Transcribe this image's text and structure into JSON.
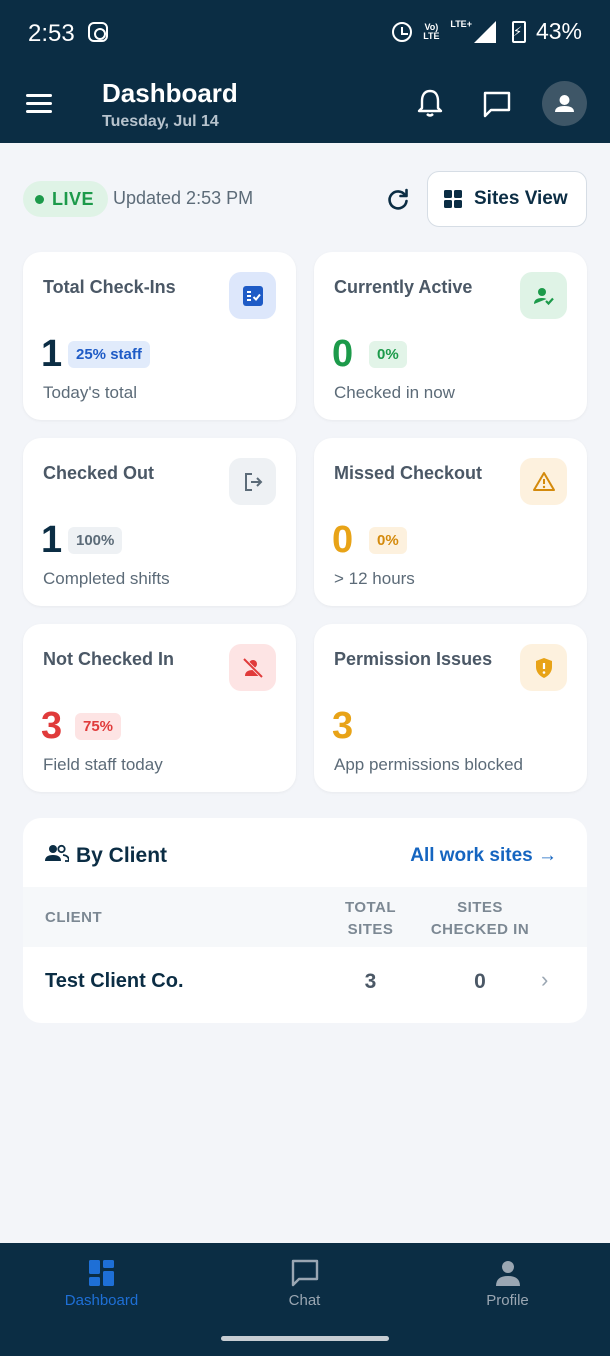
{
  "status_bar": {
    "time": "2:53",
    "volte": "Vo) LTE",
    "network": "LTE+",
    "battery": "43%"
  },
  "header": {
    "title": "Dashboard",
    "date": "Tuesday, Jul 14"
  },
  "live": {
    "label": "LIVE",
    "updated": "Updated 2:53 PM"
  },
  "sites_view_label": "Sites View",
  "cards": [
    {
      "title": "Total Check-Ins",
      "value": "1",
      "badge": "25% staff",
      "subtitle": "Today's total",
      "icon": "checklist-icon",
      "value_color": "#0b2d44",
      "icon_bg": "#dde7fb",
      "icon_color": "#1e5bc6",
      "badge_bg": "#e1ebfb",
      "badge_color": "#1e5bc6"
    },
    {
      "title": "Currently Active",
      "value": "0",
      "badge": "0%",
      "subtitle": "Checked in now",
      "icon": "user-check-icon",
      "value_color": "#1c9a4a",
      "icon_bg": "#dff3e6",
      "icon_color": "#1c9a4a",
      "badge_bg": "#e2f4e8",
      "badge_color": "#1c9a4a"
    },
    {
      "title": "Checked Out",
      "value": "1",
      "badge": "100%",
      "subtitle": "Completed shifts",
      "icon": "logout-icon",
      "value_color": "#0b2d44",
      "icon_bg": "#eef1f4",
      "icon_color": "#5c6b78",
      "badge_bg": "#eef1f4",
      "badge_color": "#5c6b78"
    },
    {
      "title": "Missed Checkout",
      "value": "0",
      "badge": "0%",
      "subtitle": "> 12 hours",
      "icon": "warning-icon",
      "value_color": "#e8a317",
      "icon_bg": "#fdf1de",
      "icon_color": "#d48a0c",
      "badge_bg": "#fdf1de",
      "badge_color": "#d48a0c"
    },
    {
      "title": "Not Checked In",
      "value": "3",
      "badge": "75%",
      "subtitle": "Field staff today",
      "icon": "user-off-icon",
      "value_color": "#e03b3b",
      "icon_bg": "#fde4e4",
      "icon_color": "#e03b3b",
      "badge_bg": "#fde4e4",
      "badge_color": "#e03b3b"
    },
    {
      "title": "Permission Issues",
      "value": "3",
      "badge": "",
      "subtitle": "App permissions blocked",
      "icon": "shield-alert-icon",
      "value_color": "#e8a317",
      "icon_bg": "#fdf1de",
      "icon_color": "#e8a317",
      "badge_bg": "",
      "badge_color": ""
    }
  ],
  "by_client": {
    "title": "By Client",
    "all_link": "All work sites →",
    "columns": {
      "client": "CLIENT",
      "total_sites": "TOTAL SITES",
      "sites_checked_in": "SITES CHECKED IN"
    },
    "rows": [
      {
        "client": "Test Client Co.",
        "total_sites": "3",
        "sites_checked_in": "0"
      }
    ]
  },
  "bottom_nav": [
    {
      "label": "Dashboard",
      "icon": "dashboard-icon",
      "active": true
    },
    {
      "label": "Chat",
      "icon": "chat-icon",
      "active": false
    },
    {
      "label": "Profile",
      "icon": "profile-icon",
      "active": false
    }
  ],
  "colors": {
    "primary_dark": "#0b2d44",
    "accent_blue": "#1565c0",
    "background": "#f3f5f9"
  }
}
